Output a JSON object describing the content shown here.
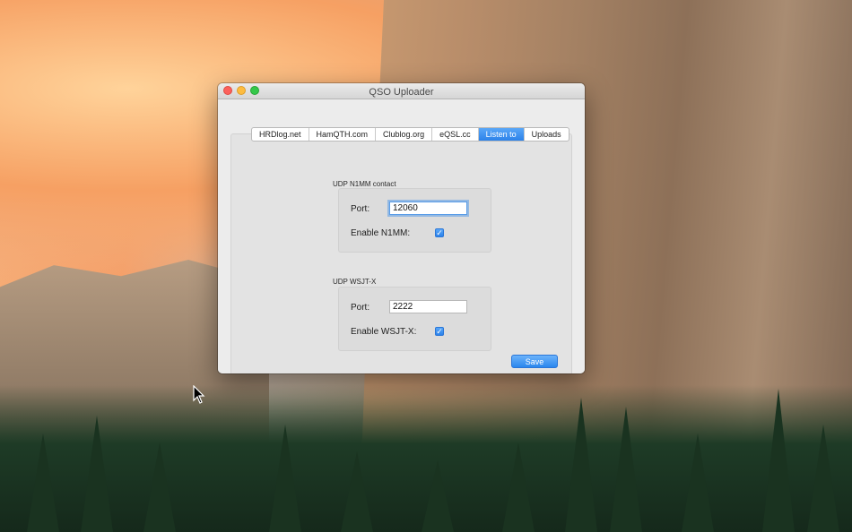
{
  "window": {
    "title": "QSO Uploader"
  },
  "tabs": [
    {
      "label": "HRDlog.net",
      "active": false
    },
    {
      "label": "HamQTH.com",
      "active": false
    },
    {
      "label": "Clublog.org",
      "active": false
    },
    {
      "label": "eQSL.cc",
      "active": false
    },
    {
      "label": "Listen to",
      "active": true
    },
    {
      "label": "Uploads",
      "active": false
    }
  ],
  "n1mm": {
    "group_label": "UDP N1MM contact",
    "port_label": "Port:",
    "port_value": "12060",
    "enable_label": "Enable N1MM:",
    "enabled": true
  },
  "wsjtx": {
    "group_label": "UDP WSJT-X",
    "port_label": "Port:",
    "port_value": "2222",
    "enable_label": "Enable WSJT-X:",
    "enabled": true
  },
  "actions": {
    "save_label": "Save"
  },
  "colors": {
    "accent": "#2c82ea"
  }
}
